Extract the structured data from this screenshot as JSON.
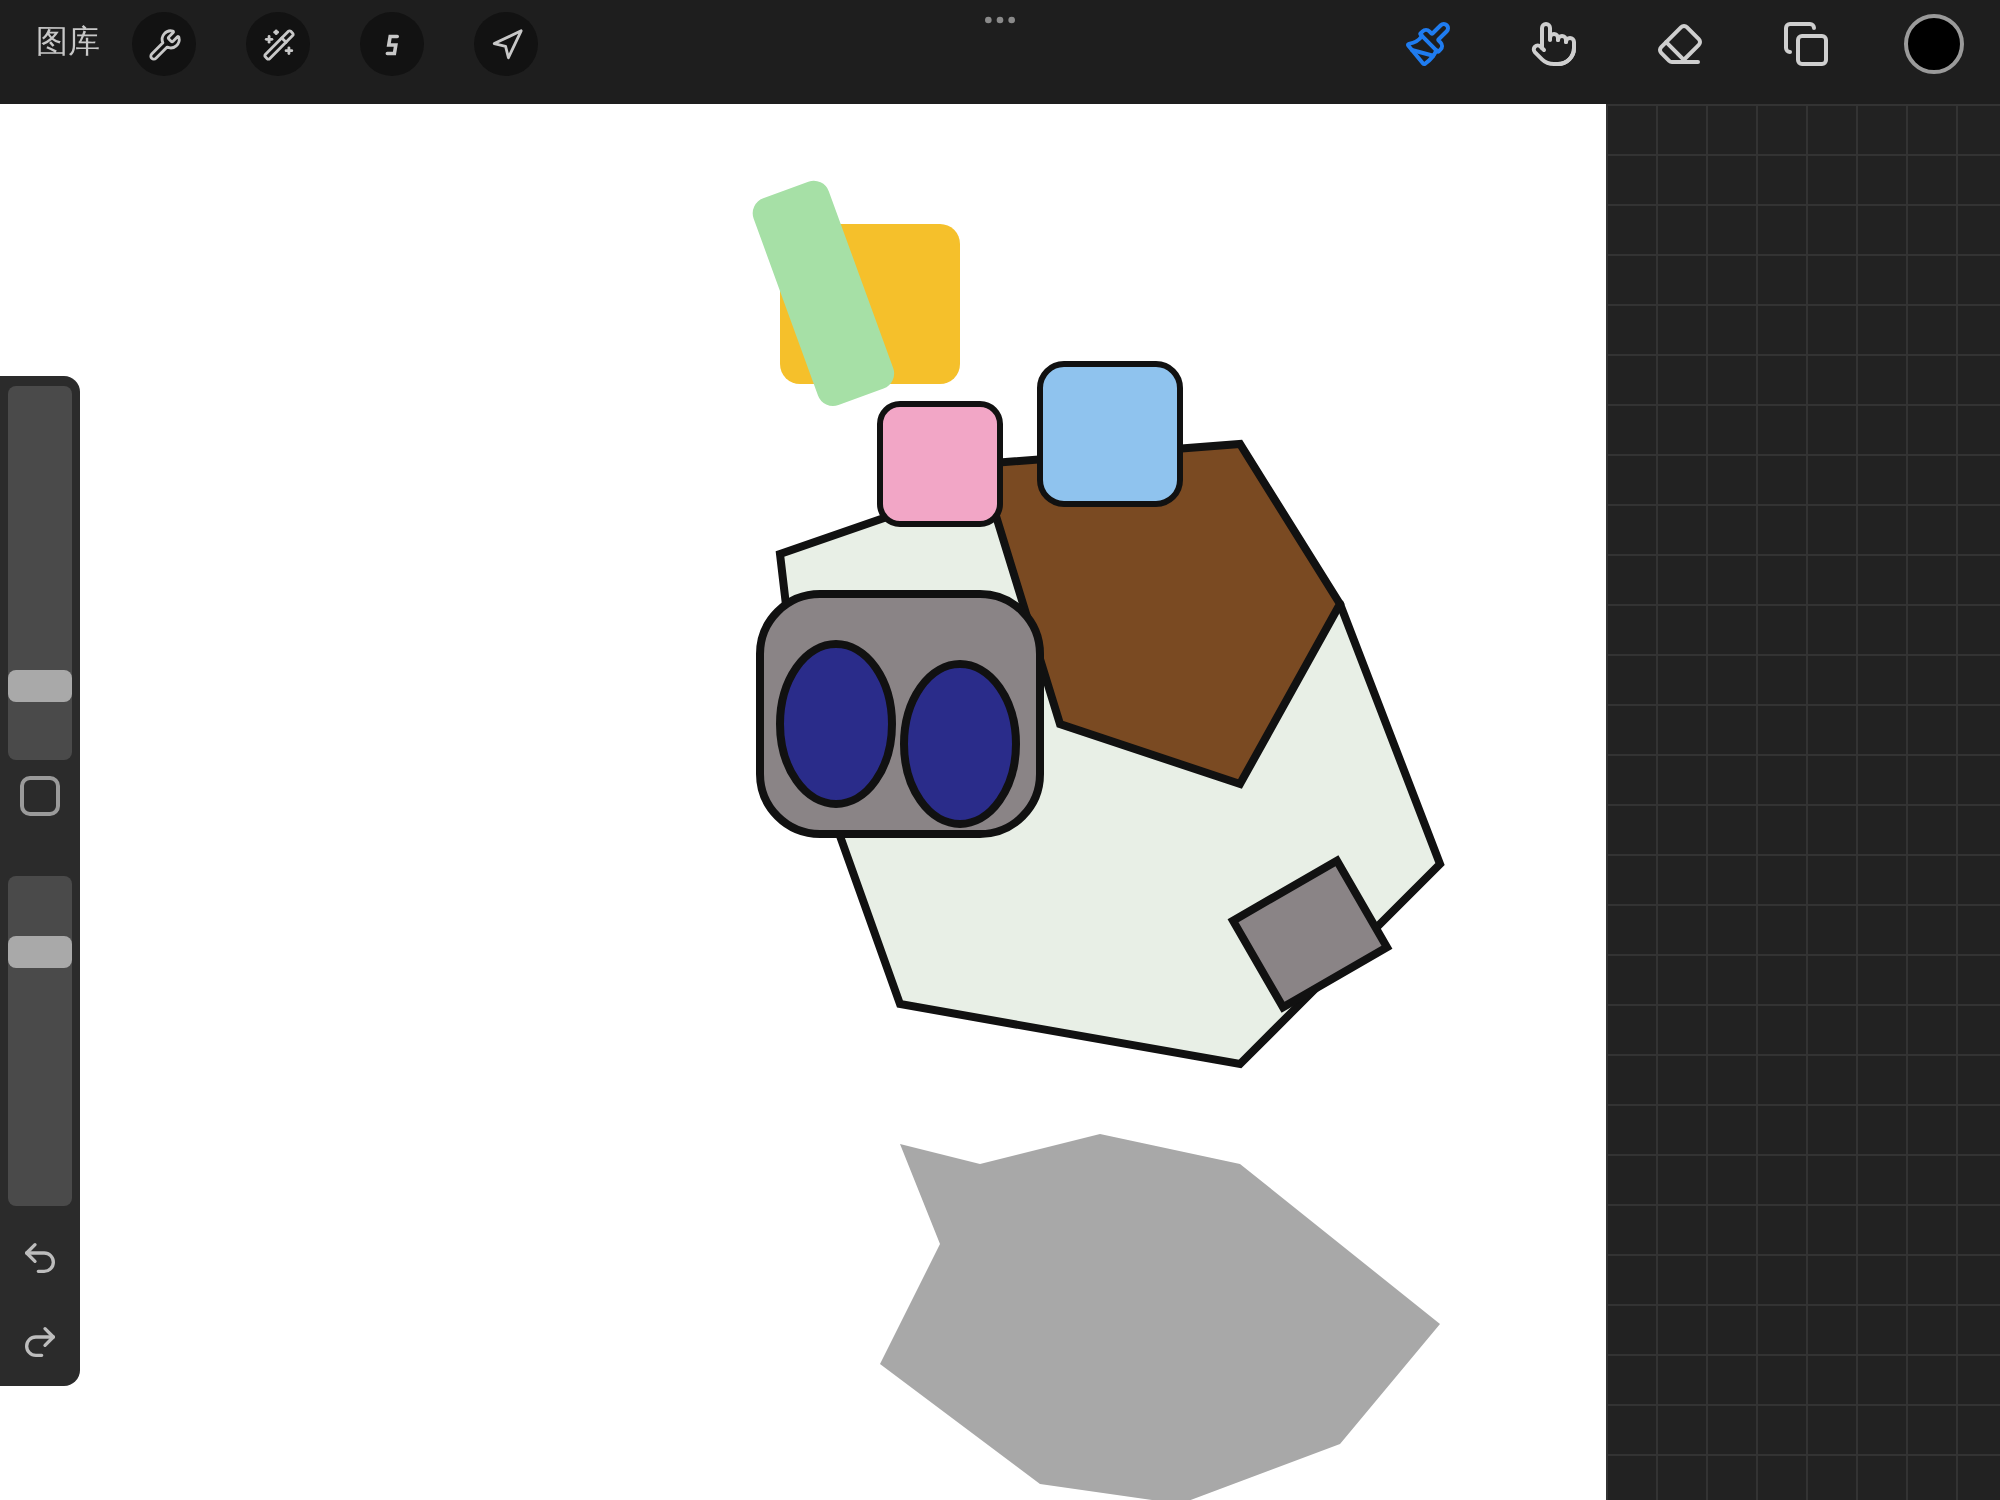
{
  "top_bar": {
    "gallery_label": "图库",
    "left_tools": [
      {
        "kind": "wrench",
        "selected": false
      },
      {
        "kind": "wand",
        "selected": false
      },
      {
        "kind": "selection",
        "selected": false
      },
      {
        "kind": "arrow",
        "selected": false
      }
    ],
    "right_tools": [
      {
        "kind": "brush",
        "selected": true
      },
      {
        "kind": "smudge",
        "selected": false
      },
      {
        "kind": "eraser",
        "selected": false
      },
      {
        "kind": "layers",
        "selected": false
      }
    ],
    "color_swatch": {
      "color": "#000000"
    }
  },
  "sidebar": {
    "size_slider": {
      "level": 0.17
    },
    "opacity_slider": {
      "level": 0.8
    }
  }
}
